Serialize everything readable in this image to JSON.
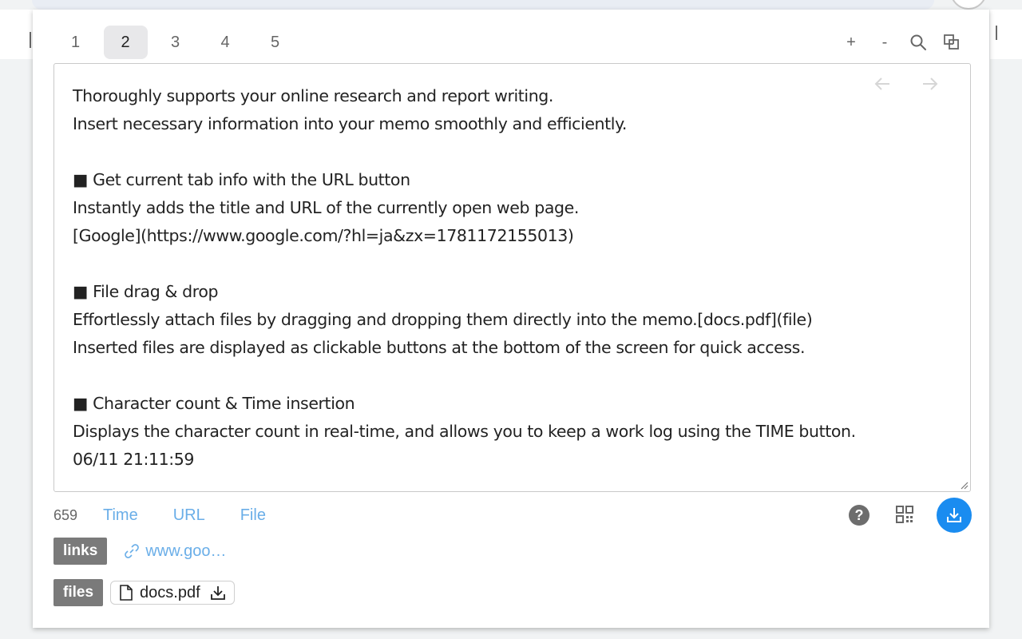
{
  "tabs": [
    "1",
    "2",
    "3",
    "4",
    "5"
  ],
  "active_tab": "2",
  "toolbar": {
    "zoom_in": "+",
    "zoom_out": "-",
    "search_icon": "search-icon",
    "copy_icon": "copy-icon"
  },
  "nav": {
    "back_icon": "arrow-left-icon",
    "forward_icon": "arrow-right-icon"
  },
  "memo": {
    "text": "Thoroughly supports your online research and report writing.\nInsert necessary information into your memo smoothly and efficiently.\n\n■ Get current tab info with the URL button\nInstantly adds the title and URL of the currently open web page.\n[Google](https://www.google.com/?hl=ja&zx=1781172155013)\n\n■ File drag & drop\nEffortlessly attach files by dragging and dropping them directly into the memo.[docs.pdf](file)\nInserted files are displayed as clickable buttons at the bottom of the screen for quick access.\n\n■ Character count & Time insertion\nDisplays the character count in real-time, and allows you to keep a work log using the TIME button.\n06/11 21:11:59"
  },
  "status": {
    "char_count": "659",
    "time_label": "Time",
    "url_label": "URL",
    "file_label": "File"
  },
  "right_actions": {
    "help_label": "?",
    "qr_icon": "qr-code-icon",
    "download_icon": "download-icon"
  },
  "links": {
    "tag": "links",
    "items": [
      {
        "label": "www.goo…",
        "icon": "link-icon"
      }
    ]
  },
  "files": {
    "tag": "files",
    "items": [
      {
        "label": "docs.pdf",
        "icon": "file-icon",
        "action_icon": "download-icon"
      }
    ]
  },
  "colors": {
    "accent_link": "#6aaee8",
    "primary_button": "#1a8cf0",
    "tag_bg": "#7a7a7a",
    "active_tab_bg": "#e8e8ea"
  }
}
